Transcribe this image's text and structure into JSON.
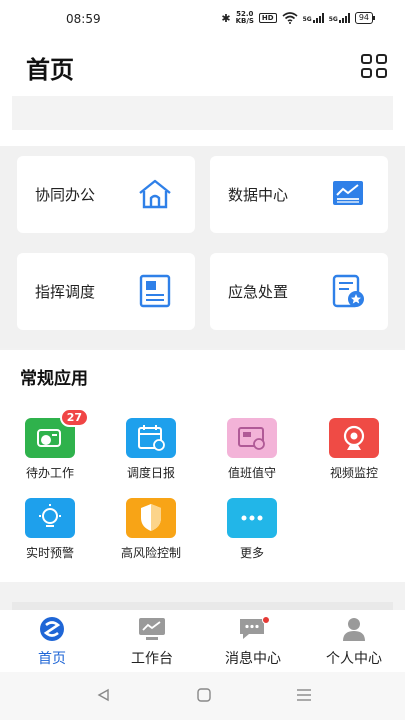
{
  "status": {
    "time": "08:59",
    "speed_value": "52.0",
    "speed_unit": "KB/S",
    "hd": "HD",
    "net1": "5G",
    "net2": "5G",
    "battery": "94"
  },
  "header": {
    "title": "首页",
    "menu_icon": "grid-icon"
  },
  "cards": [
    {
      "label": "协同办公",
      "icon": "home-icon"
    },
    {
      "label": "数据中心",
      "icon": "chart-monitor-icon"
    },
    {
      "label": "指挥调度",
      "icon": "document-icon"
    },
    {
      "label": "应急处置",
      "icon": "certificate-icon"
    }
  ],
  "apps": {
    "title": "常规应用",
    "items": [
      {
        "label": "待办工作",
        "color": "#2fb24c",
        "badge": "27"
      },
      {
        "label": "调度日报",
        "color": "#1ea0ec"
      },
      {
        "label": "值班值守",
        "color": "#f3b3d8"
      },
      {
        "label": "视频监控",
        "color": "#ef4b45"
      },
      {
        "label": "实时预警",
        "color": "#1ea0ec"
      },
      {
        "label": "高风险控制",
        "color": "#f8a416"
      },
      {
        "label": "更多",
        "color": "#22b6e8"
      }
    ]
  },
  "tabs": [
    {
      "label": "首页",
      "active": true
    },
    {
      "label": "工作台"
    },
    {
      "label": "消息中心"
    },
    {
      "label": "个人中心"
    }
  ],
  "colors": {
    "accent": "#1f66d6",
    "icon_blue": "#2f80e8"
  }
}
